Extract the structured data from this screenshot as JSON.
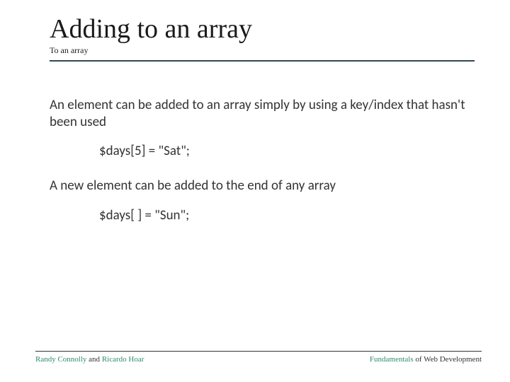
{
  "header": {
    "title": "Adding to an array",
    "subtitle": "To an array"
  },
  "content": {
    "para1": "An element can be added to an array simply by using a key/index that hasn't been used",
    "code1": "$days[5] = \"Sat\";",
    "para2": "A new element can be added to the end of any array",
    "code2": "$days[ ] = \"Sun\";"
  },
  "footer": {
    "left": {
      "author1": "Randy Connolly",
      "joiner": " and ",
      "author2": "Ricardo Hoar"
    },
    "right": {
      "word1": "Fundamentals",
      "rest": " of Web Development"
    }
  }
}
